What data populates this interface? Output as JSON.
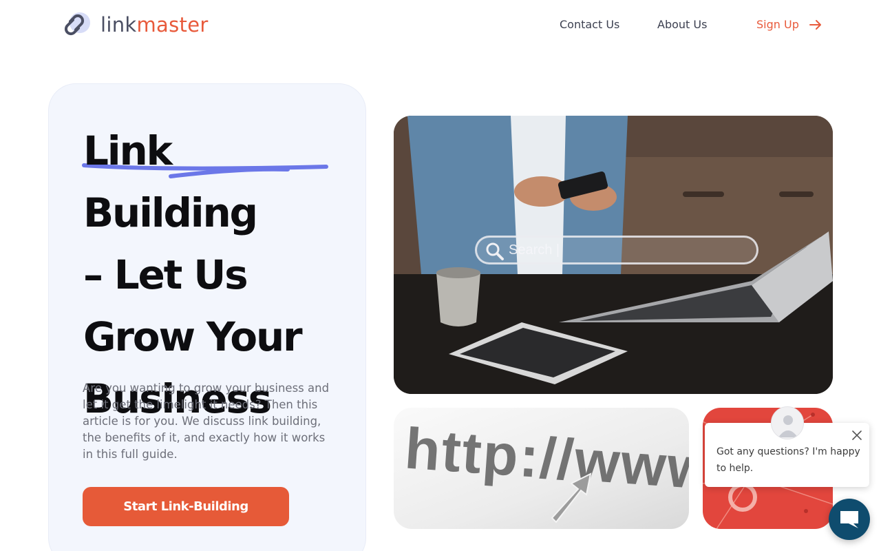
{
  "header": {
    "logo_link": "link",
    "logo_master": "master",
    "nav": {
      "contact": "Contact Us",
      "about": "About Us",
      "signup": "Sign Up"
    }
  },
  "hero": {
    "title_line1": "Link Building",
    "title_line2": "– Let Us",
    "title_line3": "Grow Your",
    "title_line4": "Business",
    "description": "Are you wanting to grow your business and let it get the limelight it needs? Then this article is for you. We discuss link building, the benefits of it, and exactly how it works in this full guide.",
    "cta_label": "Start Link-Building"
  },
  "images": {
    "search_overlay_text": "Search |",
    "url_text": "http://www"
  },
  "chat": {
    "message": "Got any questions? I'm happy to help."
  },
  "colors": {
    "brand_orange": "#e85a3b",
    "brand_purple": "#6b77e8",
    "hero_bg": "#f3f6fd",
    "chat_launcher": "#0f4c6e"
  },
  "icons": {
    "logo": "chain-link-icon",
    "signup_arrow": "arrow-right-icon",
    "search": "search-icon",
    "close": "close-icon",
    "chat": "chat-bubble-icon",
    "avatar": "user-avatar-icon"
  }
}
